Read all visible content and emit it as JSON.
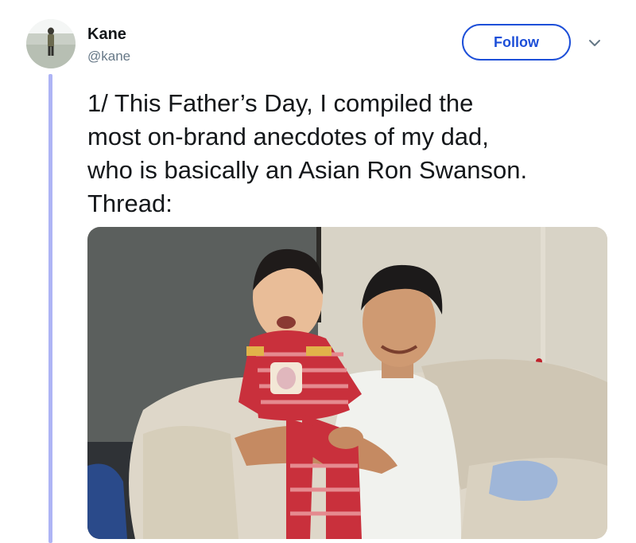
{
  "author": {
    "name": "Kane",
    "handle": "@kane"
  },
  "actions": {
    "follow_label": "Follow"
  },
  "tweet": {
    "text_lines": [
      "1/ This Father’s Day, I compiled the",
      "most on-brand anecdotes of my dad,",
      "who is basically an Asian Ron Swanson.",
      "Thread:"
    ]
  },
  "colors": {
    "accent": "#1d4fd8",
    "thread_line": "#aeb4f5",
    "handle_gray": "#657786"
  },
  "icons": {
    "more": "chevron-down-icon"
  }
}
